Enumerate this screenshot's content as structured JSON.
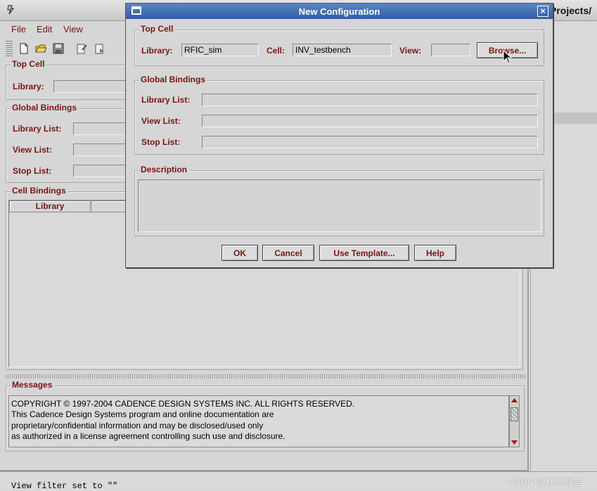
{
  "main_window": {
    "title_fragment": "Projects/",
    "menu": [
      "File",
      "Edit",
      "View"
    ],
    "top_cell": {
      "legend": "Top Cell",
      "library_label": "Library:"
    },
    "global_bindings": {
      "legend": "Global Bindings",
      "library_list_label": "Library List:",
      "view_list_label": "View List:",
      "stop_list_label": "Stop List:"
    },
    "cell_bindings": {
      "legend": "Cell Bindings",
      "columns": [
        "Library",
        ""
      ]
    },
    "messages": {
      "legend": "Messages",
      "lines": [
        "COPYRIGHT © 1997-2004 CADENCE DESIGN SYSTEMS INC.  ALL RIGHTS RESERVED.",
        "This Cadence Design Systems program and online documentation are",
        "proprietary/confidential information and may be disclosed/used only",
        "as authorized in a license agreement controlling such use and disclosure."
      ]
    },
    "status_text": "View filter set to \"\""
  },
  "dialog": {
    "title": "New Configuration",
    "close_glyph": "×",
    "top_cell": {
      "legend": "Top Cell",
      "library_label": "Library:",
      "library_value": "RFIC_sim",
      "cell_label": "Cell:",
      "cell_value": "INV_testbench",
      "view_label": "View:",
      "view_value": "",
      "browse_label": "Browse..."
    },
    "global_bindings": {
      "legend": "Global Bindings",
      "library_list_label": "Library List:",
      "library_list_value": "",
      "view_list_label": "View List:",
      "view_list_value": "",
      "stop_list_label": "Stop List:",
      "stop_list_value": ""
    },
    "description": {
      "legend": "Description",
      "value": ""
    },
    "buttons": {
      "ok": "OK",
      "cancel": "Cancel",
      "use_template": "Use Template...",
      "help": "Help"
    }
  },
  "watermark": "CSDN @林清海笙",
  "icons": [
    "app-icon",
    "new-file-icon",
    "open-folder-icon",
    "save-icon",
    "edit-doc-icon",
    "edit-doc2-icon",
    "mouse-cursor-icon",
    "close-icon",
    "scroll-up-icon",
    "scroll-down-icon"
  ],
  "colors": {
    "label_maroon": "#7a1414",
    "dialog_title_blue": "#3d6db2",
    "background_gray": "#d6d6d6"
  }
}
